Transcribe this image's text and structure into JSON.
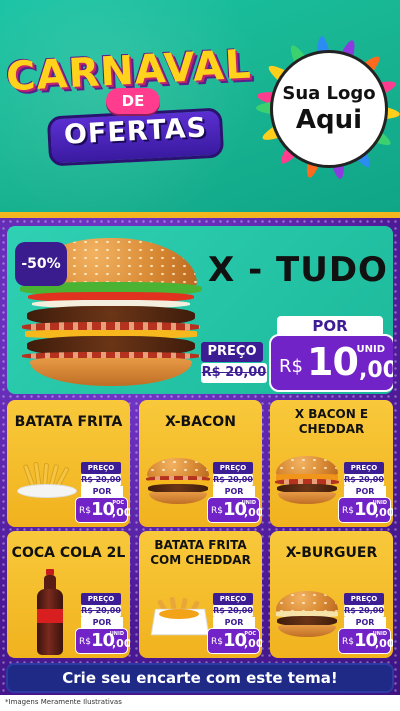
{
  "header": {
    "title_line1": "CARNAVAL",
    "title_line2": "DE",
    "title_line3": "OFERTAS",
    "logo_line1": "Sua Logo",
    "logo_line2": "Aqui"
  },
  "featured": {
    "discount": "-50%",
    "name": "X - TUDO",
    "preco_label": "PREÇO",
    "old_price": "R$ 20,00",
    "por_label": "POR",
    "currency": "R$",
    "price_int": "10",
    "price_cents": ",00",
    "unit": "UNID"
  },
  "products": [
    {
      "name": "BATATA FRITA",
      "preco_label": "PREÇO",
      "old_price": "R$ 20,00",
      "por_label": "POR",
      "currency": "R$",
      "price_int": "10",
      "price_cents": ",00",
      "unit": "POC"
    },
    {
      "name": "X-BACON",
      "preco_label": "PREÇO",
      "old_price": "R$ 20,00",
      "por_label": "POR",
      "currency": "R$",
      "price_int": "10",
      "price_cents": ",00",
      "unit": "UNID"
    },
    {
      "name": "X BACON E CHEDDAR",
      "preco_label": "PREÇO",
      "old_price": "R$ 20,00",
      "por_label": "POR",
      "currency": "R$",
      "price_int": "10",
      "price_cents": ",00",
      "unit": "UNID"
    },
    {
      "name": "COCA COLA 2L",
      "preco_label": "PREÇO",
      "old_price": "R$ 20,00",
      "por_label": "POR",
      "currency": "R$",
      "price_int": "10",
      "price_cents": ",00",
      "unit": "UNID"
    },
    {
      "name": "BATATA FRITA COM CHEDDAR",
      "preco_label": "PREÇO",
      "old_price": "R$ 20,00",
      "por_label": "POR",
      "currency": "R$",
      "price_int": "10",
      "price_cents": ",00",
      "unit": "POC"
    },
    {
      "name": "X-BURGUER",
      "preco_label": "PREÇO",
      "old_price": "R$ 20,00",
      "por_label": "POR",
      "currency": "R$",
      "price_int": "10",
      "price_cents": ",00",
      "unit": "UNID"
    }
  ],
  "cta": "Crie seu encarte com este tema!",
  "footer_note": "*Imagens Meramente Ilustrativas",
  "colors": {
    "header_bg": "#19b693",
    "feature_bg": "#1cb99a",
    "card_bg": "#f1b21e",
    "accent_purple": "#7223c7",
    "label_purple": "#3d1d94",
    "cta_bg": "#1e2a86"
  }
}
